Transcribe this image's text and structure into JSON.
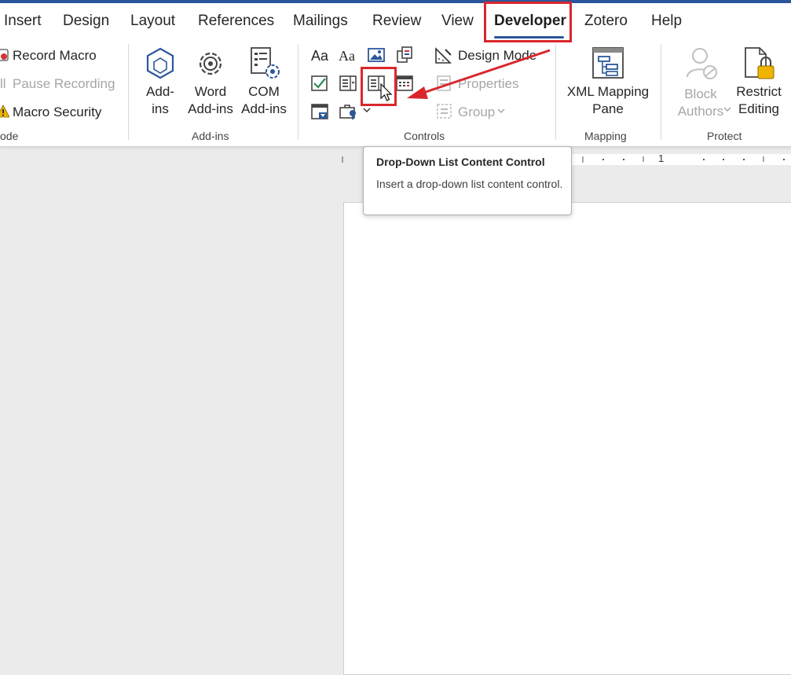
{
  "tabs": [
    "Insert",
    "Design",
    "Layout",
    "References",
    "Mailings",
    "Review",
    "View",
    "Developer",
    "Zotero",
    "Help"
  ],
  "active_tab": "Developer",
  "code_group": {
    "label": "ode",
    "record_macro": "Record Macro",
    "pause_recording": "Pause Recording",
    "pause_prefix": "ll",
    "macro_security": "Macro Security"
  },
  "addins_group": {
    "label": "Add-ins",
    "addins": [
      "Add-",
      "ins"
    ],
    "word_addins": [
      "Word",
      "Add-ins"
    ],
    "com_addins": [
      "COM",
      "Add-ins"
    ]
  },
  "controls_group": {
    "label": "Controls",
    "rich_text_glyph": "Aa",
    "plain_text_glyph": "Aa",
    "design_mode": "Design Mode",
    "properties": "Properties",
    "group": "Group"
  },
  "mapping_group": {
    "label": "Mapping",
    "xml_mapping": [
      "XML Mapping",
      "Pane"
    ]
  },
  "protect_group": {
    "label": "Protect",
    "block_authors": [
      "Block",
      "Authors"
    ],
    "restrict_editing": [
      "Restrict",
      "Editing"
    ]
  },
  "tooltip": {
    "title": "Drop-Down List Content Control",
    "description": "Insert a drop-down list content control."
  },
  "ruler": {
    "number": "1"
  },
  "colors": {
    "accent": "#2b579a",
    "highlight": "#d9262c"
  }
}
